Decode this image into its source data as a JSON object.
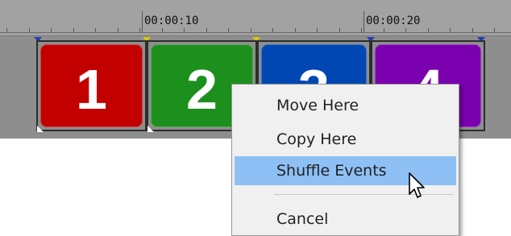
{
  "ruler": {
    "timecodes": [
      "00:00:10",
      "00:00:20"
    ]
  },
  "clips": [
    {
      "label": "1",
      "color": "#c20000"
    },
    {
      "label": "2",
      "color": "#1d8f1d"
    },
    {
      "label": "3",
      "color": "#0047b3"
    },
    {
      "label": "4",
      "color": "#7a00b0"
    }
  ],
  "context_menu": {
    "items": [
      {
        "label": "Move Here",
        "highlighted": false
      },
      {
        "label": "Copy Here",
        "highlighted": false
      },
      {
        "label": "Shuffle Events",
        "highlighted": true
      },
      {
        "label": "Cancel",
        "highlighted": false
      }
    ]
  },
  "colors": {
    "track_bg": "#8e8e8e",
    "ruler_bg": "#a2a2a2",
    "menu_bg": "#f0f0f0",
    "menu_highlight": "#8ec0f5",
    "event_handle": "#1f3fb3"
  },
  "icons": [
    "mouse-pointer-icon"
  ]
}
